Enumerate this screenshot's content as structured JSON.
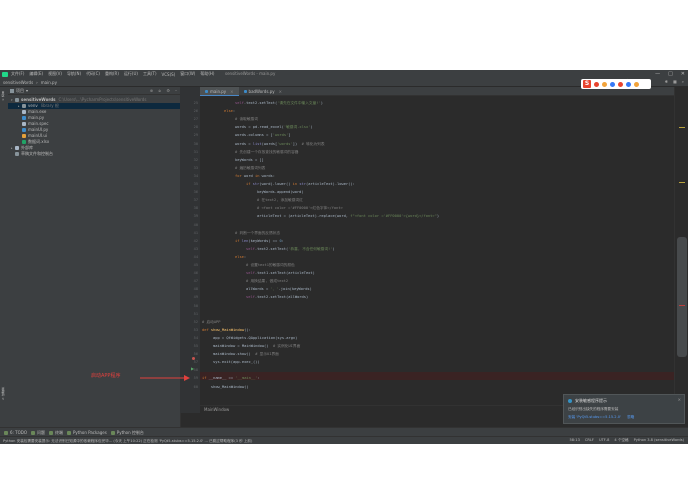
{
  "menubar": {
    "items": [
      "文件(F)",
      "编辑(E)",
      "视图(V)",
      "导航(N)",
      "代码(C)",
      "重构(R)",
      "运行(U)",
      "工具(T)",
      "VCS(S)",
      "窗口(W)",
      "帮助(H)"
    ],
    "title": "sensitiveWords - main.py",
    "window_buttons": [
      "—",
      "□",
      "✕"
    ]
  },
  "navbar": {
    "breadcrumb": [
      "sensitiveWords",
      "main.py"
    ],
    "run_config": "main",
    "sogou_text": "S"
  },
  "project": {
    "title": "项目",
    "rows": [
      {
        "label": "sensitiveWords",
        "path": "C:\\Users\\...\\PycharmProjects\\sensitiveWords",
        "level": 0,
        "icon": "folder",
        "arrow": "▾"
      },
      {
        "label": "venv",
        "path": "library 根",
        "level": 1,
        "icon": "folder",
        "arrow": "▸",
        "selected": true
      },
      {
        "label": "main.exe",
        "path": "",
        "level": 1,
        "icon": "lib",
        "arrow": ""
      },
      {
        "label": "main.py",
        "path": "",
        "level": 1,
        "icon": "py",
        "arrow": ""
      },
      {
        "label": "main.spec",
        "path": "",
        "level": 1,
        "icon": "lib",
        "arrow": ""
      },
      {
        "label": "mainUI.py",
        "path": "",
        "level": 1,
        "icon": "py",
        "arrow": ""
      },
      {
        "label": "mainUI.ui",
        "path": "",
        "level": 1,
        "icon": "ui",
        "arrow": ""
      },
      {
        "label": "数据词.xlsx",
        "path": "",
        "level": 1,
        "icon": "xls",
        "arrow": ""
      },
      {
        "label": "外部库",
        "path": "",
        "level": 0,
        "icon": "lib",
        "arrow": "▸"
      },
      {
        "label": "草稿文件和控制台",
        "path": "",
        "level": 0,
        "icon": "folder",
        "arrow": ""
      }
    ],
    "side_label_top": "1: 项目",
    "side_label_bottom": "2: 收藏夹"
  },
  "editor": {
    "tabs": [
      {
        "label": "main.py",
        "active": true
      },
      {
        "label": "badWords.py",
        "active": false
      }
    ],
    "line_numbers": [
      "25",
      "26",
      "27",
      "28",
      "29",
      "30",
      "31",
      "32",
      "33",
      "34",
      "35",
      "36",
      "37",
      "38",
      "39",
      "40",
      "41",
      "42",
      "43",
      "44",
      "45",
      "46",
      "47",
      "48",
      "49",
      "50",
      "51",
      "52",
      "53",
      "54",
      "55",
      "56",
      "57",
      "58"
    ],
    "lines": [
      [
        [
          "self",
          "self"
        ],
        [
          "p",
          ".text2.setText("
        ],
        [
          "str",
          "'请先在文件中输入文章!'"
        ],
        [
          "p",
          ")"
        ]
      ],
      [
        [
          "kw",
          "else"
        ],
        [
          "p",
          ":"
        ]
      ],
      [
        [
          "cm",
          "# 读取敏感词"
        ]
      ],
      [
        [
          "p",
          "words = pd.read_excel("
        ],
        [
          "str",
          "'敏感词.xlsx'"
        ],
        [
          "p",
          ")"
        ]
      ],
      [
        [
          "p",
          "words.columns = ["
        ],
        [
          "str",
          "'words'"
        ],
        [
          "p",
          "]"
        ]
      ],
      [
        [
          "p",
          "words = "
        ],
        [
          "bi",
          "list"
        ],
        [
          "p",
          "(words["
        ],
        [
          "str",
          "'words'"
        ],
        [
          "p",
          "])  "
        ],
        [
          "cm",
          "# 转化为列表"
        ]
      ],
      [
        [
          "cm",
          "# 先创建一个存放查找的敏感词的容器"
        ]
      ],
      [
        [
          "p",
          "keyWords = []"
        ]
      ],
      [
        [
          "cm",
          "# 遍历敏感词列表"
        ]
      ],
      [
        [
          "kw",
          "for "
        ],
        [
          "p",
          "word "
        ],
        [
          "kw",
          "in "
        ],
        [
          "p",
          "words:"
        ]
      ],
      [
        [
          "kw",
          "if "
        ],
        [
          "bi",
          "str"
        ],
        [
          "p",
          "(word).lower() "
        ],
        [
          "kw",
          "in "
        ],
        [
          "bi",
          "str"
        ],
        [
          "p",
          "(articleText).lower():"
        ]
      ],
      [
        [
          "p",
          "keyWords.append(word)"
        ]
      ],
      [
        [
          "cm",
          "# 在text2, 添加敏感词红"
        ]
      ],
      [
        [
          "cm",
          "# <font color ='#FF0000'>红色字体</font>"
        ]
      ],
      [
        [
          "p",
          "articleText = (articleText).replace(word, "
        ],
        [
          "str",
          "f\"<font color ='#FF0000'>{word}</font>\""
        ],
        [
          "p",
          ")"
        ]
      ],
      [
        [
          "p",
          ""
        ]
      ],
      [
        [
          "cm",
          "# 判断一个界面的反馈状态"
        ]
      ],
      [
        [
          "kw",
          "if "
        ],
        [
          "bi",
          "len"
        ],
        [
          "p",
          "(keyWords) == "
        ],
        [
          "num",
          "0"
        ],
        [
          "p",
          ":"
        ]
      ],
      [
        [
          "self",
          "self"
        ],
        [
          "p",
          ".text2.setText("
        ],
        [
          "str",
          "'恭喜, 不含任何敏感词!'"
        ],
        [
          "p",
          ")"
        ]
      ],
      [
        [
          "kw",
          "else"
        ],
        [
          "p",
          ":"
        ]
      ],
      [
        [
          "cm",
          "# 设置text1的敏感词的颜色"
        ]
      ],
      [
        [
          "self",
          "self"
        ],
        [
          "p",
          ".text1.setText(articleText)"
        ]
      ],
      [
        [
          "cm",
          "# 用换结果, 做成text2"
        ]
      ],
      [
        [
          "p",
          "allWords = "
        ],
        [
          "str",
          "'、'"
        ],
        [
          "p",
          ".join(keyWords)"
        ]
      ],
      [
        [
          "self",
          "self"
        ],
        [
          "p",
          ".text2.setText(allWords)"
        ]
      ],
      [
        [
          "p",
          ""
        ]
      ],
      [
        [
          "p",
          ""
        ]
      ],
      [
        [
          "cm",
          "# 启动APP"
        ]
      ],
      [
        [
          "kw",
          "def "
        ],
        [
          "fn",
          "show_MainWindow"
        ],
        [
          "p",
          "():"
        ]
      ],
      [
        [
          "p",
          "app = QtWidgets.QApplication(sys.argv)"
        ]
      ],
      [
        [
          "p",
          "mainWindow = MainWindow()  "
        ],
        [
          "cm",
          "# 实例化UI界面"
        ]
      ],
      [
        [
          "p",
          "mainWindow.show()  "
        ],
        [
          "cm",
          "# 显示UI界面"
        ]
      ],
      [
        [
          "p",
          "sys.exit(app.exec_())"
        ]
      ],
      [
        [
          "p",
          ""
        ]
      ]
    ],
    "indents": [
      3,
      2,
      3,
      3,
      3,
      3,
      3,
      3,
      3,
      3,
      4,
      5,
      5,
      5,
      5,
      0,
      3,
      3,
      4,
      3,
      4,
      4,
      4,
      4,
      4,
      0,
      0,
      0,
      0,
      1,
      1,
      1,
      1,
      0
    ],
    "main_block": [
      {
        "n": "59",
        "code": [
          [
            "kw",
            "if "
          ],
          [
            "p",
            "__name__ == "
          ],
          [
            "str",
            "'__main__'"
          ],
          [
            "p",
            ":"
          ]
        ]
      },
      {
        "n": "60",
        "code": [
          [
            "p",
            "    show_MainWindow()"
          ]
        ]
      }
    ],
    "breadcrumb_bottom": "MainWindow"
  },
  "bottom_tools": [
    "6: TODO",
    "问题",
    "终端",
    "Python Packages",
    "Python 控制台"
  ],
  "statusbar": {
    "message": "Python 安装包需要安装提示: 无法识别已知源中的依赖程序包完毕... (今天 上午10:22) 正在检测 'PyQt5-stubs==5.15.2.0' ... 已跳过帮助程序(3 秒 上前)",
    "right": [
      "58:13",
      "CRLF",
      "UTF-8",
      "4 个空格",
      "Python 3.8 (sensitiveWords)"
    ]
  },
  "notification": {
    "title": "安装敏感程序提示",
    "body": "已经识别出缺失的程序需要安装",
    "links": [
      "安装 'PyQt5-stubs==5.15.2.0'",
      "忽略"
    ]
  },
  "annotation": {
    "label": "启动APP程序",
    "color": "#e0403d"
  },
  "colors": {
    "accent": "#4a88c7",
    "keyword": "#cc7832",
    "string": "#6a8759"
  }
}
